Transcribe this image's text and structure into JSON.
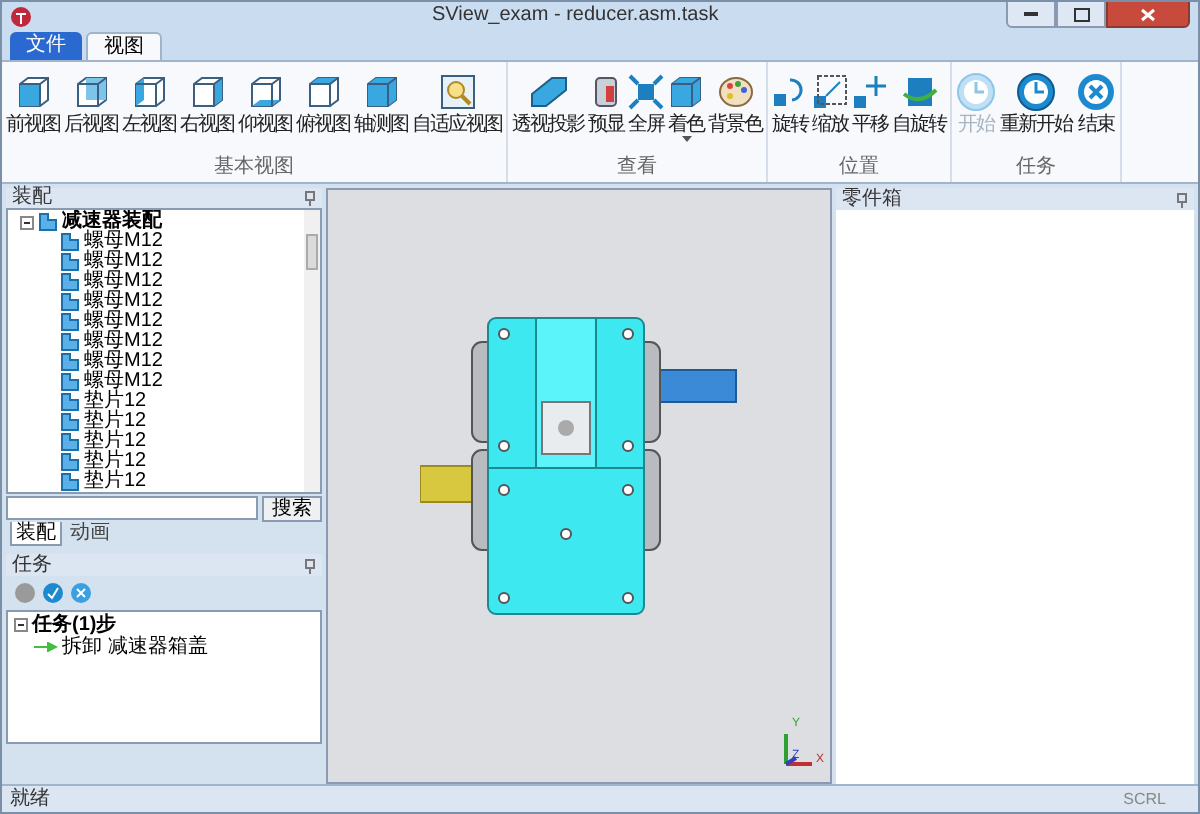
{
  "window": {
    "title": "SView_exam - reducer.asm.task"
  },
  "tabs": [
    {
      "label": "文件",
      "kind": "file",
      "selected": false
    },
    {
      "label": "视图",
      "kind": "tab",
      "selected": true
    }
  ],
  "ribbon": [
    {
      "title": "基本视图",
      "buttons": [
        {
          "label": "前视图"
        },
        {
          "label": "后视图"
        },
        {
          "label": "左视图"
        },
        {
          "label": "右视图"
        },
        {
          "label": "仰视图"
        },
        {
          "label": "俯视图"
        },
        {
          "label": "轴测图"
        },
        {
          "label": "自适应视图"
        }
      ]
    },
    {
      "title": "查看",
      "buttons": [
        {
          "label": "透视投影"
        },
        {
          "label": "预显"
        },
        {
          "label": "全屏"
        },
        {
          "label": "着色",
          "dropdown": true
        },
        {
          "label": "背景色"
        }
      ]
    },
    {
      "title": "位置",
      "buttons": [
        {
          "label": "旋转"
        },
        {
          "label": "缩放"
        },
        {
          "label": "平移"
        },
        {
          "label": "自旋转"
        }
      ]
    },
    {
      "title": "任务",
      "buttons": [
        {
          "label": "开始",
          "disabled": true
        },
        {
          "label": "重新开始",
          "disabled": false
        },
        {
          "label": "结束",
          "disabled": false
        }
      ]
    }
  ],
  "assembly_panel": {
    "title": "装配",
    "tree": {
      "label": "减速器装配",
      "expanded": true,
      "children": [
        {
          "label": "螺母M12"
        },
        {
          "label": "螺母M12"
        },
        {
          "label": "螺母M12"
        },
        {
          "label": "螺母M12"
        },
        {
          "label": "螺母M12"
        },
        {
          "label": "螺母M12"
        },
        {
          "label": "螺母M12"
        },
        {
          "label": "螺母M12"
        },
        {
          "label": "垫片12"
        },
        {
          "label": "垫片12"
        },
        {
          "label": "垫片12"
        },
        {
          "label": "垫片12"
        },
        {
          "label": "垫片12"
        }
      ]
    },
    "search_button": "搜索",
    "tabs": [
      {
        "label": "装配",
        "selected": true
      },
      {
        "label": "动画",
        "selected": false
      }
    ]
  },
  "task_panel": {
    "title": "任务",
    "tree": {
      "label": "任务(1)步",
      "expanded": true,
      "children": [
        {
          "label": "拆卸 减速器箱盖"
        }
      ]
    }
  },
  "viewport": {
    "axes": [
      "Y",
      "Z",
      "X"
    ]
  },
  "parts_panel": {
    "title": "零件箱"
  },
  "status_bar": {
    "text": "就绪",
    "indicator": "SCRL"
  }
}
